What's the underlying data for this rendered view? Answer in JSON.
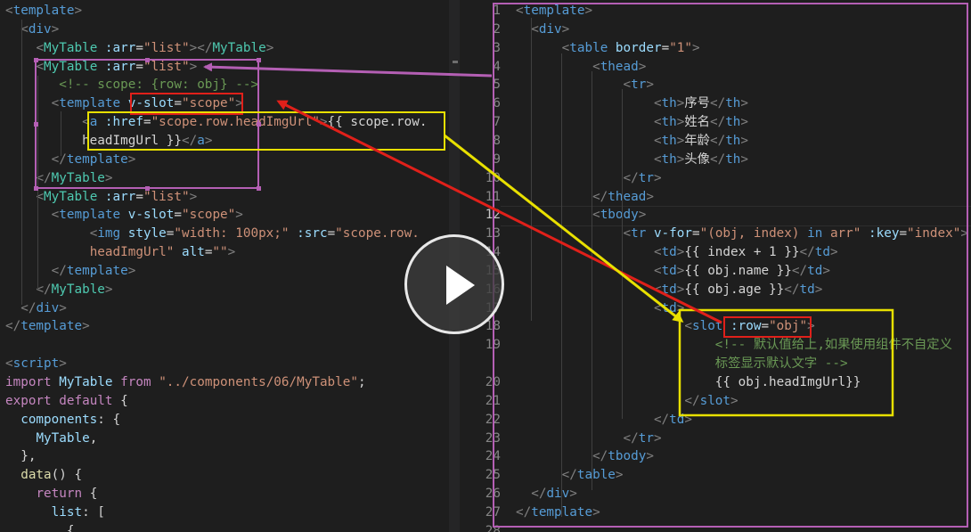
{
  "left_code": [
    [
      [
        "bracket",
        "<"
      ],
      [
        "tag",
        "template"
      ],
      [
        "bracket",
        ">"
      ]
    ],
    [
      [
        "sp",
        "  "
      ],
      [
        "bracket",
        "<"
      ],
      [
        "tag",
        "div"
      ],
      [
        "bracket",
        ">"
      ]
    ],
    [
      [
        "sp",
        "    "
      ],
      [
        "bracket",
        "<"
      ],
      [
        "comp",
        "MyTable"
      ],
      [
        "sp",
        " "
      ],
      [
        "attr",
        ":arr"
      ],
      [
        "txt",
        "="
      ],
      [
        "str",
        "\"list\""
      ],
      [
        "bracket",
        "></"
      ],
      [
        "comp",
        "MyTable"
      ],
      [
        "bracket",
        ">"
      ]
    ],
    [
      [
        "sp",
        "    "
      ],
      [
        "bracket",
        "<"
      ],
      [
        "comp",
        "MyTable"
      ],
      [
        "sp",
        " "
      ],
      [
        "attr",
        ":arr"
      ],
      [
        "txt",
        "="
      ],
      [
        "str",
        "\"list\""
      ],
      [
        "bracket",
        ">"
      ]
    ],
    [
      [
        "sp",
        "       "
      ],
      [
        "cmt",
        "<!-- scope: {row: obj} -->"
      ]
    ],
    [
      [
        "sp",
        "      "
      ],
      [
        "bracket",
        "<"
      ],
      [
        "tag",
        "template"
      ],
      [
        "sp",
        " "
      ],
      [
        "attr",
        "v-slot"
      ],
      [
        "txt",
        "="
      ],
      [
        "str",
        "\"scope\""
      ],
      [
        "bracket",
        ">"
      ]
    ],
    [
      [
        "sp",
        "          "
      ],
      [
        "bracket",
        "<"
      ],
      [
        "tag",
        "a"
      ],
      [
        "sp",
        " "
      ],
      [
        "attr",
        ":href"
      ],
      [
        "txt",
        "="
      ],
      [
        "str",
        "\"scope.row.headImgUrl\""
      ],
      [
        "bracket",
        ">"
      ],
      [
        "txt",
        "{{ scope.row."
      ]
    ],
    [
      [
        "sp",
        "          "
      ],
      [
        "txt",
        "headImgUrl }}"
      ],
      [
        "bracket",
        "</"
      ],
      [
        "tag",
        "a"
      ],
      [
        "bracket",
        ">"
      ]
    ],
    [
      [
        "sp",
        "      "
      ],
      [
        "bracket",
        "</"
      ],
      [
        "tag",
        "template"
      ],
      [
        "bracket",
        ">"
      ]
    ],
    [
      [
        "sp",
        "    "
      ],
      [
        "bracket",
        "</"
      ],
      [
        "comp",
        "MyTable"
      ],
      [
        "bracket",
        ">"
      ]
    ],
    [
      [
        "sp",
        "    "
      ],
      [
        "bracket",
        "<"
      ],
      [
        "comp",
        "MyTable"
      ],
      [
        "sp",
        " "
      ],
      [
        "attr",
        ":arr"
      ],
      [
        "txt",
        "="
      ],
      [
        "str",
        "\"list\""
      ],
      [
        "bracket",
        ">"
      ]
    ],
    [
      [
        "sp",
        "      "
      ],
      [
        "bracket",
        "<"
      ],
      [
        "tag",
        "template"
      ],
      [
        "sp",
        " "
      ],
      [
        "attr",
        "v-slot"
      ],
      [
        "txt",
        "="
      ],
      [
        "str",
        "\"scope\""
      ],
      [
        "bracket",
        ">"
      ]
    ],
    [
      [
        "sp",
        "           "
      ],
      [
        "bracket",
        "<"
      ],
      [
        "tag",
        "img"
      ],
      [
        "sp",
        " "
      ],
      [
        "attr",
        "style"
      ],
      [
        "txt",
        "="
      ],
      [
        "str",
        "\"width: 100px;\""
      ],
      [
        "sp",
        " "
      ],
      [
        "attr",
        ":src"
      ],
      [
        "txt",
        "="
      ],
      [
        "str",
        "\"scope.row."
      ]
    ],
    [
      [
        "sp",
        "           "
      ],
      [
        "str",
        "headImgUrl\""
      ],
      [
        "sp",
        " "
      ],
      [
        "attr",
        "alt"
      ],
      [
        "txt",
        "="
      ],
      [
        "str",
        "\"\""
      ],
      [
        "bracket",
        ">"
      ]
    ],
    [
      [
        "sp",
        "      "
      ],
      [
        "bracket",
        "</"
      ],
      [
        "tag",
        "template"
      ],
      [
        "bracket",
        ">"
      ]
    ],
    [
      [
        "sp",
        "    "
      ],
      [
        "bracket",
        "</"
      ],
      [
        "comp",
        "MyTable"
      ],
      [
        "bracket",
        ">"
      ]
    ],
    [
      [
        "sp",
        "  "
      ],
      [
        "bracket",
        "</"
      ],
      [
        "tag",
        "div"
      ],
      [
        "bracket",
        ">"
      ]
    ],
    [
      [
        "bracket",
        "</"
      ],
      [
        "tag",
        "template"
      ],
      [
        "bracket",
        ">"
      ]
    ],
    [],
    [
      [
        "bracket",
        "<"
      ],
      [
        "tag",
        "script"
      ],
      [
        "bracket",
        ">"
      ]
    ],
    [
      [
        "kw",
        "import"
      ],
      [
        "sp",
        " "
      ],
      [
        "attr",
        "MyTable"
      ],
      [
        "sp",
        " "
      ],
      [
        "kw",
        "from"
      ],
      [
        "sp",
        " "
      ],
      [
        "str",
        "\"../components/06/MyTable\""
      ],
      [
        "txt",
        ";"
      ]
    ],
    [
      [
        "kw",
        "export"
      ],
      [
        "sp",
        " "
      ],
      [
        "kw",
        "default"
      ],
      [
        "sp",
        " "
      ],
      [
        "txt",
        "{"
      ]
    ],
    [
      [
        "sp",
        "  "
      ],
      [
        "attr",
        "components"
      ],
      [
        "txt",
        ": {"
      ]
    ],
    [
      [
        "sp",
        "    "
      ],
      [
        "attr",
        "MyTable"
      ],
      [
        "txt",
        ","
      ]
    ],
    [
      [
        "sp",
        "  "
      ],
      [
        "txt",
        "},"
      ]
    ],
    [
      [
        "sp",
        "  "
      ],
      [
        "fn",
        "data"
      ],
      [
        "txt",
        "() {"
      ]
    ],
    [
      [
        "sp",
        "    "
      ],
      [
        "kw",
        "return"
      ],
      [
        "sp",
        " "
      ],
      [
        "txt",
        "{"
      ]
    ],
    [
      [
        "sp",
        "      "
      ],
      [
        "attr",
        "list"
      ],
      [
        "txt",
        ": ["
      ]
    ],
    [
      [
        "sp",
        "        "
      ],
      [
        "txt",
        "{"
      ]
    ]
  ],
  "right_line_numbers": [
    "1",
    "2",
    "3",
    "4",
    "5",
    "6",
    "7",
    "8",
    "9",
    "10",
    "11",
    "12",
    "13",
    "14",
    "15",
    "16",
    "17",
    "18",
    "19",
    "",
    "20",
    "21",
    "22",
    "23",
    "24",
    "25",
    "26",
    "27",
    "28"
  ],
  "current_line_number": "12",
  "right_code": [
    [
      [
        "bracket",
        "<"
      ],
      [
        "tag",
        "template"
      ],
      [
        "bracket",
        ">"
      ]
    ],
    [
      [
        "sp",
        "  "
      ],
      [
        "bracket",
        "<"
      ],
      [
        "tag",
        "div"
      ],
      [
        "bracket",
        ">"
      ]
    ],
    [
      [
        "sp",
        "      "
      ],
      [
        "bracket",
        "<"
      ],
      [
        "tag",
        "table"
      ],
      [
        "sp",
        " "
      ],
      [
        "attr",
        "border"
      ],
      [
        "txt",
        "="
      ],
      [
        "str",
        "\"1\""
      ],
      [
        "bracket",
        ">"
      ]
    ],
    [
      [
        "sp",
        "          "
      ],
      [
        "bracket",
        "<"
      ],
      [
        "tag",
        "thead"
      ],
      [
        "bracket",
        ">"
      ]
    ],
    [
      [
        "sp",
        "              "
      ],
      [
        "bracket",
        "<"
      ],
      [
        "tag",
        "tr"
      ],
      [
        "bracket",
        ">"
      ]
    ],
    [
      [
        "sp",
        "                  "
      ],
      [
        "bracket",
        "<"
      ],
      [
        "tag",
        "th"
      ],
      [
        "bracket",
        ">"
      ],
      [
        "txt",
        "序号"
      ],
      [
        "bracket",
        "</"
      ],
      [
        "tag",
        "th"
      ],
      [
        "bracket",
        ">"
      ]
    ],
    [
      [
        "sp",
        "                  "
      ],
      [
        "bracket",
        "<"
      ],
      [
        "tag",
        "th"
      ],
      [
        "bracket",
        ">"
      ],
      [
        "txt",
        "姓名"
      ],
      [
        "bracket",
        "</"
      ],
      [
        "tag",
        "th"
      ],
      [
        "bracket",
        ">"
      ]
    ],
    [
      [
        "sp",
        "                  "
      ],
      [
        "bracket",
        "<"
      ],
      [
        "tag",
        "th"
      ],
      [
        "bracket",
        ">"
      ],
      [
        "txt",
        "年龄"
      ],
      [
        "bracket",
        "</"
      ],
      [
        "tag",
        "th"
      ],
      [
        "bracket",
        ">"
      ]
    ],
    [
      [
        "sp",
        "                  "
      ],
      [
        "bracket",
        "<"
      ],
      [
        "tag",
        "th"
      ],
      [
        "bracket",
        ">"
      ],
      [
        "txt",
        "头像"
      ],
      [
        "bracket",
        "</"
      ],
      [
        "tag",
        "th"
      ],
      [
        "bracket",
        ">"
      ]
    ],
    [
      [
        "sp",
        "              "
      ],
      [
        "bracket",
        "</"
      ],
      [
        "tag",
        "tr"
      ],
      [
        "bracket",
        ">"
      ]
    ],
    [
      [
        "sp",
        "          "
      ],
      [
        "bracket",
        "</"
      ],
      [
        "tag",
        "thead"
      ],
      [
        "bracket",
        ">"
      ]
    ],
    [
      [
        "sp",
        "          "
      ],
      [
        "bracket",
        "<"
      ],
      [
        "tag",
        "tbody"
      ],
      [
        "bracket",
        ">"
      ]
    ],
    [
      [
        "sp",
        "              "
      ],
      [
        "bracket",
        "<"
      ],
      [
        "tag",
        "tr"
      ],
      [
        "sp",
        " "
      ],
      [
        "attr",
        "v-for"
      ],
      [
        "txt",
        "="
      ],
      [
        "str",
        "\"(obj, index) "
      ],
      [
        "kw2",
        "in"
      ],
      [
        "str",
        " arr\""
      ],
      [
        "sp",
        " "
      ],
      [
        "attr",
        ":key"
      ],
      [
        "txt",
        "="
      ],
      [
        "str",
        "\"index\""
      ],
      [
        "bracket",
        ">"
      ]
    ],
    [
      [
        "sp",
        "                  "
      ],
      [
        "bracket",
        "<"
      ],
      [
        "tag",
        "td"
      ],
      [
        "bracket",
        ">"
      ],
      [
        "txt",
        "{{ index + 1 }}"
      ],
      [
        "bracket",
        "</"
      ],
      [
        "tag",
        "td"
      ],
      [
        "bracket",
        ">"
      ]
    ],
    [
      [
        "sp",
        "                  "
      ],
      [
        "bracket",
        "<"
      ],
      [
        "tag",
        "td"
      ],
      [
        "bracket",
        ">"
      ],
      [
        "txt",
        "{{ obj.name }}"
      ],
      [
        "bracket",
        "</"
      ],
      [
        "tag",
        "td"
      ],
      [
        "bracket",
        ">"
      ]
    ],
    [
      [
        "sp",
        "                  "
      ],
      [
        "bracket",
        "<"
      ],
      [
        "tag",
        "td"
      ],
      [
        "bracket",
        ">"
      ],
      [
        "txt",
        "{{ obj.age }}"
      ],
      [
        "bracket",
        "</"
      ],
      [
        "tag",
        "td"
      ],
      [
        "bracket",
        ">"
      ]
    ],
    [
      [
        "sp",
        "                  "
      ],
      [
        "bracket",
        "<"
      ],
      [
        "tag",
        "td"
      ],
      [
        "bracket",
        ">"
      ]
    ],
    [
      [
        "sp",
        "                      "
      ],
      [
        "bracket",
        "<"
      ],
      [
        "tag",
        "slot"
      ],
      [
        "sp",
        " "
      ],
      [
        "attr",
        ":row"
      ],
      [
        "txt",
        "="
      ],
      [
        "str",
        "\"obj\""
      ],
      [
        "bracket",
        ">"
      ]
    ],
    [
      [
        "sp",
        "                          "
      ],
      [
        "cmt",
        "<!-- 默认值给上,如果使用组件不自定义"
      ]
    ],
    [
      [
        "sp",
        "                          "
      ],
      [
        "cmt",
        "标签显示默认文字 -->"
      ]
    ],
    [
      [
        "sp",
        "                          "
      ],
      [
        "txt",
        "{{ obj.headImgUrl}}"
      ]
    ],
    [
      [
        "sp",
        "                      "
      ],
      [
        "bracket",
        "</"
      ],
      [
        "tag",
        "slot"
      ],
      [
        "bracket",
        ">"
      ]
    ],
    [
      [
        "sp",
        "                  "
      ],
      [
        "bracket",
        "</"
      ],
      [
        "tag",
        "td"
      ],
      [
        "bracket",
        ">"
      ]
    ],
    [
      [
        "sp",
        "              "
      ],
      [
        "bracket",
        "</"
      ],
      [
        "tag",
        "tr"
      ],
      [
        "bracket",
        ">"
      ]
    ],
    [
      [
        "sp",
        "          "
      ],
      [
        "bracket",
        "</"
      ],
      [
        "tag",
        "tbody"
      ],
      [
        "bracket",
        ">"
      ]
    ],
    [
      [
        "sp",
        "      "
      ],
      [
        "bracket",
        "</"
      ],
      [
        "tag",
        "table"
      ],
      [
        "bracket",
        ">"
      ]
    ],
    [
      [
        "sp",
        "  "
      ],
      [
        "bracket",
        "</"
      ],
      [
        "tag",
        "div"
      ],
      [
        "bracket",
        ">"
      ]
    ],
    [
      [
        "bracket",
        "</"
      ],
      [
        "tag",
        "template"
      ],
      [
        "bracket",
        ">"
      ]
    ],
    []
  ],
  "colors": {
    "editor_bg": "#1e1e1e",
    "annotation_purple": "#b45fb4",
    "annotation_red": "#e0201a",
    "annotation_yellow": "#e8e000"
  },
  "player": {
    "play_icon": "play-icon"
  }
}
